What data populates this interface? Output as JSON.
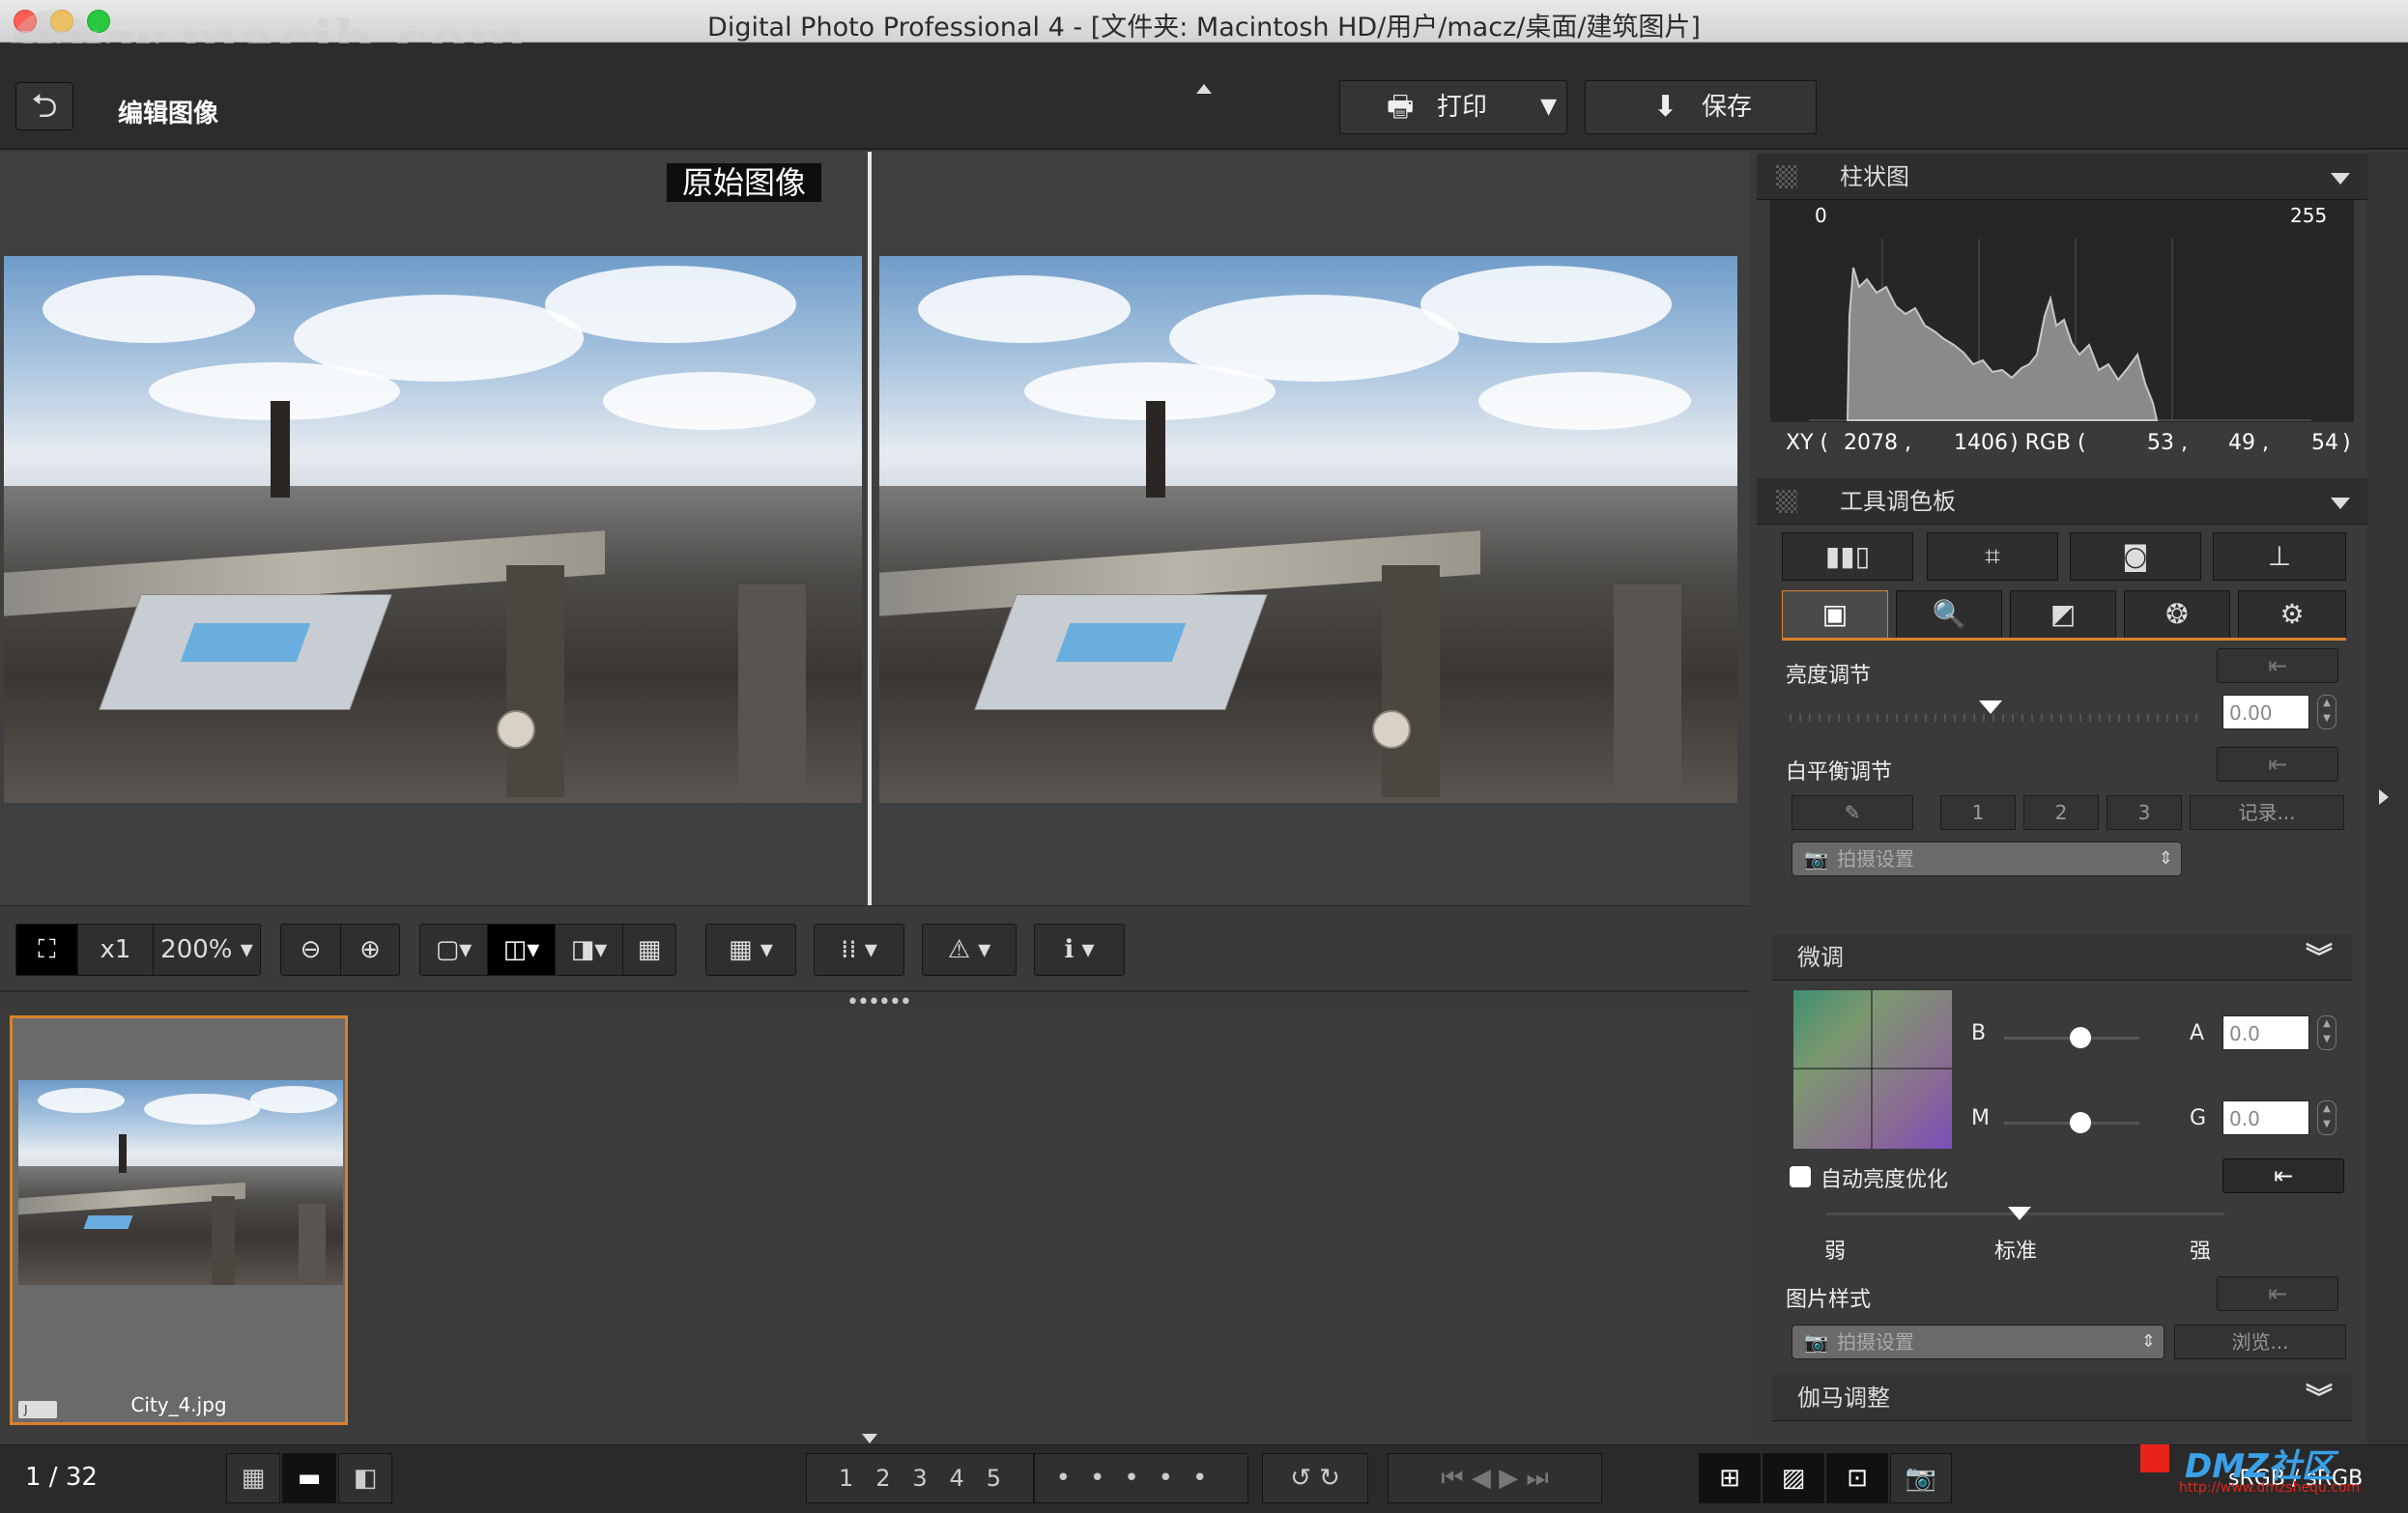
{
  "window": {
    "title": "Digital Photo Professional 4 - [文件夹: Macintosh HD/用户/macz/桌面/建筑图片]",
    "watermark": "www.macjb.com"
  },
  "toolbar": {
    "page_title": "编辑图像",
    "print_label": "打印",
    "save_label": "保存"
  },
  "viewer": {
    "original_label": "原始图像"
  },
  "view_toolbar": {
    "zoom_multiplier": "x1",
    "zoom_level": "200%"
  },
  "filmstrip": {
    "items": [
      {
        "name": "City_4.jpg",
        "badge": "J"
      }
    ]
  },
  "status": {
    "counter": "1 / 32",
    "color_space": "sRGB / sRGB",
    "ratings": [
      "1",
      "2",
      "3",
      "4",
      "5"
    ]
  },
  "panel": {
    "histogram": {
      "title": "柱状图",
      "min": "0",
      "max": "255",
      "xy_label": "XY (",
      "x": "2078 ,",
      "y": "1406",
      "rgb_label": ") RGB (",
      "r": "53 ,",
      "g": "49 ,",
      "b": "54",
      "close": ")"
    },
    "tool_palette": {
      "title": "工具调色板",
      "brightness_label": "亮度调节",
      "brightness_value": "0.00",
      "wb_label": "白平衡调节",
      "wb_presets": [
        "1",
        "2",
        "3"
      ],
      "wb_record": "记录...",
      "wb_select": "拍摄设置",
      "fine_tune_label": "微调",
      "b_label": "B",
      "a_label": "A",
      "ba_value": "0.0",
      "m_label": "M",
      "g_label": "G",
      "mg_value": "0.0",
      "auto_lighting_label": "自动亮度优化",
      "weak": "弱",
      "standard": "标准",
      "strong": "强",
      "picture_style_label": "图片样式",
      "picture_style_select": "拍摄设置",
      "browse_label": "浏览...",
      "gamma_label": "伽马调整"
    }
  },
  "dmz": {
    "text": "DMZ社区",
    "url": "http://www.dmzshequ.com"
  },
  "colors": {
    "accent": "#d9822b",
    "panel_bg": "#3a3a3a",
    "toolbar_bg": "#2c2c2c"
  }
}
